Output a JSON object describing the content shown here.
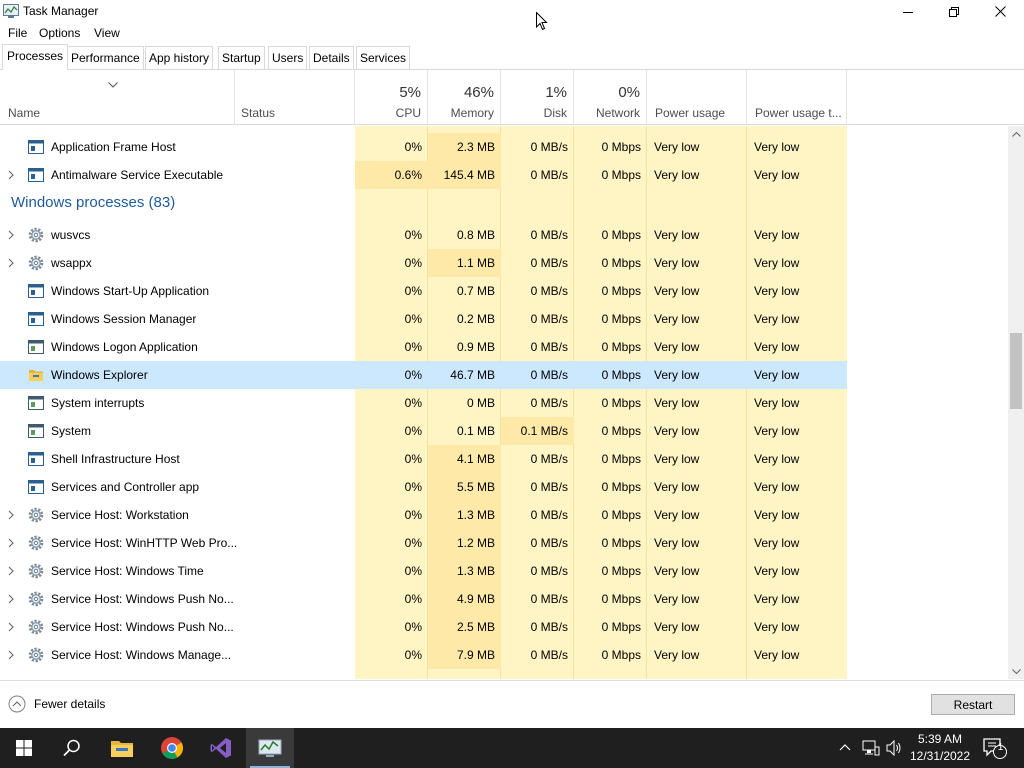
{
  "window": {
    "title": "Task Manager"
  },
  "menu": [
    "File",
    "Options",
    "View"
  ],
  "tabs": [
    "Processes",
    "Performance",
    "App history",
    "Startup",
    "Users",
    "Details",
    "Services"
  ],
  "header": {
    "name": "Name",
    "status": "Status",
    "cpu_pct": "5%",
    "cpu": "CPU",
    "mem_pct": "46%",
    "memory": "Memory",
    "disk_pct": "1%",
    "disk": "Disk",
    "net_pct": "0%",
    "network": "Network",
    "power": "Power usage",
    "power_trend": "Power usage t..."
  },
  "rows_top": [
    {
      "name": "Application Frame Host",
      "expand": false,
      "icon": "app-window-icon",
      "cpu": "0%",
      "mem": "2.3 MB",
      "disk": "0 MB/s",
      "net": "0 Mbps",
      "power": "Very low",
      "trend": "Very low"
    },
    {
      "name": "Antimalware Service Executable",
      "expand": true,
      "icon": "app-window-icon",
      "cpu": "0.6%",
      "mem": "145.4 MB",
      "disk": "0 MB/s",
      "net": "0 Mbps",
      "power": "Very low",
      "trend": "Very low",
      "cpu_hot": true
    }
  ],
  "group": {
    "title": "Windows processes (83)"
  },
  "rows": [
    {
      "name": "wusvcs",
      "expand": true,
      "icon": "gear-icon",
      "cpu": "0%",
      "mem": "0.8 MB",
      "disk": "0 MB/s",
      "net": "0 Mbps",
      "power": "Very low",
      "trend": "Very low"
    },
    {
      "name": "wsappx",
      "expand": true,
      "icon": "gear-icon",
      "cpu": "0%",
      "mem": "1.1 MB",
      "disk": "0 MB/s",
      "net": "0 Mbps",
      "power": "Very low",
      "trend": "Very low"
    },
    {
      "name": "Windows Start-Up Application",
      "expand": false,
      "icon": "app-window-icon",
      "cpu": "0%",
      "mem": "0.7 MB",
      "disk": "0 MB/s",
      "net": "0 Mbps",
      "power": "Very low",
      "trend": "Very low"
    },
    {
      "name": "Windows Session Manager",
      "expand": false,
      "icon": "app-window-icon",
      "cpu": "0%",
      "mem": "0.2 MB",
      "disk": "0 MB/s",
      "net": "0 Mbps",
      "power": "Very low",
      "trend": "Very low"
    },
    {
      "name": "Windows Logon Application",
      "expand": false,
      "icon": "system-window-icon",
      "cpu": "0%",
      "mem": "0.9 MB",
      "disk": "0 MB/s",
      "net": "0 Mbps",
      "power": "Very low",
      "trend": "Very low"
    },
    {
      "name": "Windows Explorer",
      "expand": false,
      "icon": "folder-icon",
      "cpu": "0%",
      "mem": "46.7 MB",
      "disk": "0 MB/s",
      "net": "0 Mbps",
      "power": "Very low",
      "trend": "Very low",
      "selected": true
    },
    {
      "name": "System interrupts",
      "expand": false,
      "icon": "system-window-icon",
      "cpu": "0%",
      "mem": "0 MB",
      "disk": "0 MB/s",
      "net": "0 Mbps",
      "power": "Very low",
      "trend": "Very low"
    },
    {
      "name": "System",
      "expand": false,
      "icon": "system-window-icon",
      "cpu": "0%",
      "mem": "0.1 MB",
      "disk": "0.1 MB/s",
      "net": "0 Mbps",
      "power": "Very low",
      "trend": "Very low",
      "disk_hot": true
    },
    {
      "name": "Shell Infrastructure Host",
      "expand": false,
      "icon": "app-window-icon",
      "cpu": "0%",
      "mem": "4.1 MB",
      "disk": "0 MB/s",
      "net": "0 Mbps",
      "power": "Very low",
      "trend": "Very low"
    },
    {
      "name": "Services and Controller app",
      "expand": false,
      "icon": "app-window-icon",
      "cpu": "0%",
      "mem": "5.5 MB",
      "disk": "0 MB/s",
      "net": "0 Mbps",
      "power": "Very low",
      "trend": "Very low"
    },
    {
      "name": "Service Host: Workstation",
      "expand": true,
      "icon": "gear-icon",
      "cpu": "0%",
      "mem": "1.3 MB",
      "disk": "0 MB/s",
      "net": "0 Mbps",
      "power": "Very low",
      "trend": "Very low"
    },
    {
      "name": "Service Host: WinHTTP Web Pro...",
      "expand": true,
      "icon": "gear-icon",
      "cpu": "0%",
      "mem": "1.2 MB",
      "disk": "0 MB/s",
      "net": "0 Mbps",
      "power": "Very low",
      "trend": "Very low"
    },
    {
      "name": "Service Host: Windows Time",
      "expand": true,
      "icon": "gear-icon",
      "cpu": "0%",
      "mem": "1.3 MB",
      "disk": "0 MB/s",
      "net": "0 Mbps",
      "power": "Very low",
      "trend": "Very low"
    },
    {
      "name": "Service Host: Windows Push No...",
      "expand": true,
      "icon": "gear-icon",
      "cpu": "0%",
      "mem": "4.9 MB",
      "disk": "0 MB/s",
      "net": "0 Mbps",
      "power": "Very low",
      "trend": "Very low"
    },
    {
      "name": "Service Host: Windows Push No...",
      "expand": true,
      "icon": "gear-icon",
      "cpu": "0%",
      "mem": "2.5 MB",
      "disk": "0 MB/s",
      "net": "0 Mbps",
      "power": "Very low",
      "trend": "Very low"
    },
    {
      "name": "Service Host: Windows Manage...",
      "expand": true,
      "icon": "gear-icon",
      "cpu": "0%",
      "mem": "7.9 MB",
      "disk": "0 MB/s",
      "net": "0 Mbps",
      "power": "Very low",
      "trend": "Very low"
    }
  ],
  "footer": {
    "fewer_details": "Fewer details",
    "restart": "Restart"
  },
  "taskbar": {
    "time": "5:39 AM",
    "date": "12/31/2022",
    "notification_count": "1"
  },
  "colors": {
    "heat_light": "#fff4c4",
    "heat_mid": "#ffe9a8",
    "selection": "#cce8ff",
    "group_title": "#1e5a9e",
    "taskbar": "#1f1f1f"
  }
}
